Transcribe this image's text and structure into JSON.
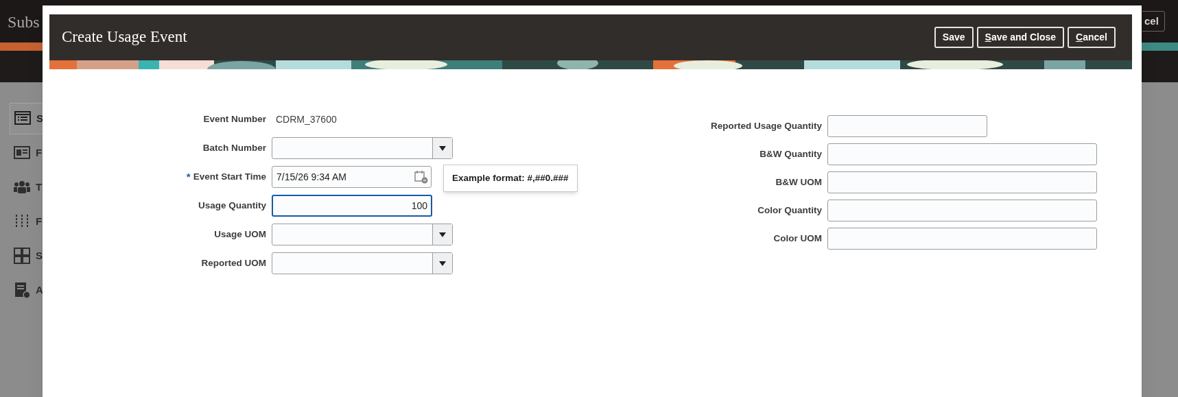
{
  "background_page": {
    "title": "Subs",
    "action_button": "cel",
    "sidebar": {
      "items": [
        {
          "label": "S",
          "selected": true
        },
        {
          "label": "F",
          "selected": false
        },
        {
          "label": "T",
          "selected": false
        },
        {
          "label": "F",
          "selected": false
        },
        {
          "label": "S",
          "selected": false
        },
        {
          "label": "A",
          "selected": false
        }
      ]
    }
  },
  "dialog": {
    "title": "Create Usage Event",
    "buttons": [
      {
        "label": "Save",
        "access_key": false
      },
      {
        "label": "Save and Close",
        "access_key": true
      },
      {
        "label": "Cancel",
        "access_key": true
      }
    ],
    "left_fields": [
      {
        "label": "Event Number",
        "kind": "text",
        "value": "CDRM_37600"
      },
      {
        "label": "Batch Number",
        "kind": "dropdown",
        "focused": false
      },
      {
        "label": "Event Start Time",
        "kind": "date",
        "value": "7/15/26 9:34 AM",
        "required_mark": "*",
        "focused": false
      },
      {
        "label": "Usage Quantity",
        "kind": "number",
        "value": "100",
        "focused": true
      },
      {
        "label": "Usage UOM",
        "kind": "dropdown",
        "focused": false
      },
      {
        "label": "Reported UOM",
        "kind": "dropdown",
        "focused": false
      }
    ],
    "right_fields": [
      {
        "label": "Reported Usage Quantity",
        "kind": "short_input"
      },
      {
        "label": "B&W Quantity",
        "kind": "input"
      },
      {
        "label": "B&W UOM",
        "kind": "input"
      },
      {
        "label": "Color Quantity",
        "kind": "input"
      },
      {
        "label": "Color UOM",
        "kind": "input"
      }
    ],
    "tooltip": "Example format: #,##0.###"
  }
}
